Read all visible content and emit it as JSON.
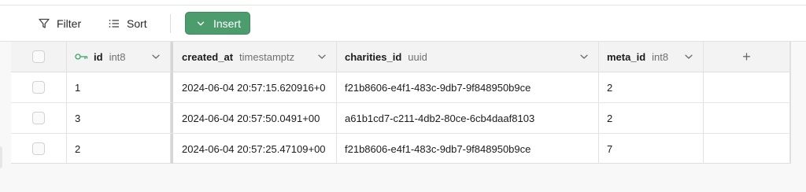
{
  "toolbar": {
    "filter_label": "Filter",
    "sort_label": "Sort",
    "insert_label": "Insert"
  },
  "columns": [
    {
      "name": "id",
      "type": "int8",
      "primary_key": true
    },
    {
      "name": "created_at",
      "type": "timestamptz"
    },
    {
      "name": "charities_id",
      "type": "uuid"
    },
    {
      "name": "meta_id",
      "type": "int8"
    }
  ],
  "add_column_label": "+",
  "rows": [
    {
      "id": "1",
      "created_at": "2024-06-04 20:57:15.620916+0",
      "charities_id": "f21b8606-e4f1-483c-9db7-9f848950b9ce",
      "meta_id": "2"
    },
    {
      "id": "3",
      "created_at": "2024-06-04 20:57:50.0491+00",
      "charities_id": "a61b1cd7-c211-4db2-80ce-6cb4daaf8103",
      "meta_id": "2"
    },
    {
      "id": "2",
      "created_at": "2024-06-04 20:57:25.47109+00",
      "charities_id": "f21b8606-e4f1-483c-9db7-9f848950b9ce",
      "meta_id": "7"
    }
  ],
  "colors": {
    "insert_bg": "#4c9c6d",
    "key_icon": "#3ea36a",
    "header_bg": "#f3f3f3"
  },
  "icons": {
    "filter": "funnel-icon",
    "sort": "sort-lines-icon",
    "insert": "chevron-down-icon",
    "primary_key": "key-icon",
    "column_menu": "chevron-down-icon"
  }
}
